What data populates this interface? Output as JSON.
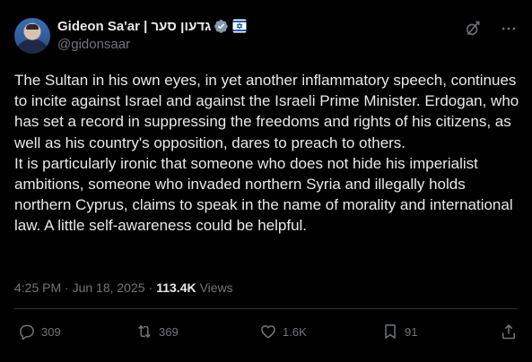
{
  "author": {
    "display_name": "Gideon Sa'ar | גדעון סער",
    "handle": "@gidonsaar",
    "verified_color": "#829aab"
  },
  "icons": {
    "grok": "grok-icon",
    "more": "more-icon",
    "reply": "reply-icon",
    "repost": "repost-icon",
    "like": "heart-icon",
    "bookmark": "bookmark-icon",
    "share": "share-icon"
  },
  "post": {
    "text": "The Sultan in his own eyes, in yet another inflammatory speech, continues to incite against Israel and against the Israeli Prime Minister. Erdogan, who has set a record in suppressing the freedoms and rights of his citizens, as well as his country's opposition, dares to preach to others.\nIt is particularly ironic that someone who does not hide his imperialist ambitions, someone who invaded northern Syria and illegally holds northern Cyprus, claims to speak in the name of morality and international law. A little self-awareness could be helpful.",
    "timestamp": "4:25 PM · Jun 18, 2025",
    "separator": "·",
    "views_count": "113.4K",
    "views_label": "Views"
  },
  "actions": {
    "replies": "309",
    "reposts": "369",
    "likes": "1.6K",
    "bookmarks": "91"
  }
}
